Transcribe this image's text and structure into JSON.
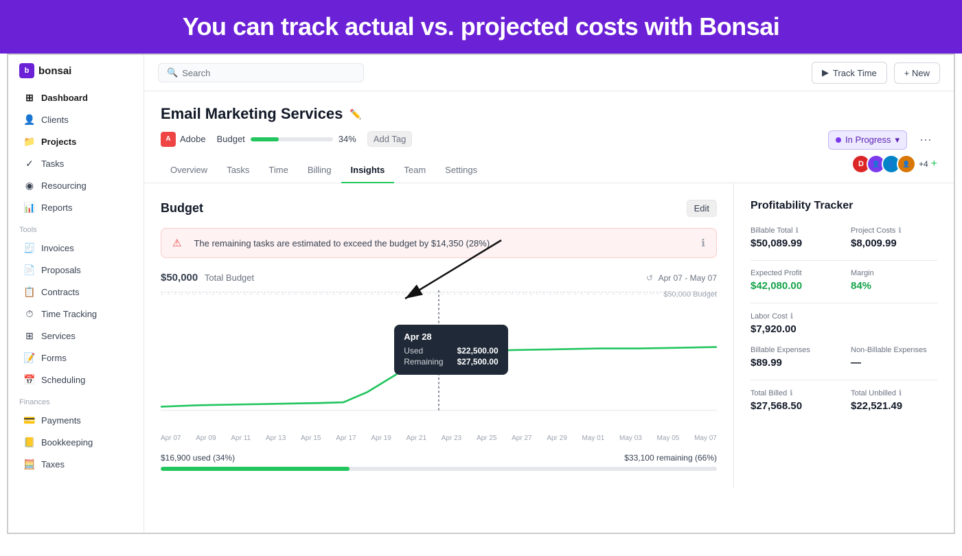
{
  "banner": {
    "text": "You can track actual vs. projected costs with Bonsai"
  },
  "topbar": {
    "search_placeholder": "Search",
    "track_time_label": "Track Time",
    "new_label": "+ New"
  },
  "sidebar": {
    "logo": "bonsai",
    "nav_items": [
      {
        "id": "dashboard",
        "label": "Dashboard",
        "icon": "⊞"
      },
      {
        "id": "clients",
        "label": "Clients",
        "icon": "👤"
      },
      {
        "id": "projects",
        "label": "Projects",
        "icon": "📁",
        "active": true
      },
      {
        "id": "tasks",
        "label": "Tasks",
        "icon": "✓"
      },
      {
        "id": "resourcing",
        "label": "Resourcing",
        "icon": "◉"
      },
      {
        "id": "reports",
        "label": "Reports",
        "icon": "📊"
      }
    ],
    "tools_section": "Tools",
    "tools_items": [
      {
        "id": "invoices",
        "label": "Invoices",
        "icon": "🧾"
      },
      {
        "id": "proposals",
        "label": "Proposals",
        "icon": "📄"
      },
      {
        "id": "contracts",
        "label": "Contracts",
        "icon": "📋"
      },
      {
        "id": "time-tracking",
        "label": "Time Tracking",
        "icon": "⏱"
      },
      {
        "id": "services",
        "label": "Services",
        "icon": "⊞"
      },
      {
        "id": "forms",
        "label": "Forms",
        "icon": "📝"
      },
      {
        "id": "scheduling",
        "label": "Scheduling",
        "icon": "📅"
      }
    ],
    "finances_section": "Finances",
    "finances_items": [
      {
        "id": "payments",
        "label": "Payments",
        "icon": "💳"
      },
      {
        "id": "bookkeeping",
        "label": "Bookkeeping",
        "icon": "📒"
      },
      {
        "id": "taxes",
        "label": "Taxes",
        "icon": "🧮"
      }
    ]
  },
  "project": {
    "title": "Email Marketing Services",
    "client": "Adobe",
    "budget_label": "Budget",
    "budget_percent": "34%",
    "budget_bar_fill": 34,
    "add_tag": "Add Tag",
    "status": "In Progress",
    "avatar_count": "+4"
  },
  "tabs": [
    {
      "id": "overview",
      "label": "Overview",
      "active": false
    },
    {
      "id": "tasks",
      "label": "Tasks",
      "active": false
    },
    {
      "id": "time",
      "label": "Time",
      "active": false
    },
    {
      "id": "billing",
      "label": "Billing",
      "active": false
    },
    {
      "id": "insights",
      "label": "Insights",
      "active": true
    },
    {
      "id": "team",
      "label": "Team",
      "active": false
    },
    {
      "id": "settings",
      "label": "Settings",
      "active": false
    }
  ],
  "budget_section": {
    "title": "Budget",
    "edit_label": "Edit",
    "alert_text": "The remaining tasks are estimated to exceed the budget by $14,350 (28%)",
    "total_budget_label": "Total Budget",
    "total_budget_value": "$50,000",
    "date_range": "Apr 07 - May 07",
    "chart_budget_line": "$50,000 Budget",
    "tooltip": {
      "date": "Apr 28",
      "used_label": "Used",
      "used_value": "$22,500.00",
      "remaining_label": "Remaining",
      "remaining_value": "$27,500.00"
    },
    "x_axis_labels": [
      "Apr 07",
      "Apr 09",
      "Apr 11",
      "Apr 13",
      "Apr 15",
      "Apr 17",
      "Apr 19",
      "Apr 21",
      "Apr 23",
      "Apr 25",
      "Apr 27",
      "Apr 29",
      "May 01",
      "May 03",
      "May 05",
      "May 07"
    ],
    "used_label": "$16,900 used (34%)",
    "remaining_label": "$33,100 remaining (66%)"
  },
  "profitability": {
    "title": "Profitability Tracker",
    "items": [
      {
        "id": "billable-total",
        "label": "Billable Total",
        "value": "$50,089.99",
        "green": false
      },
      {
        "id": "project-costs",
        "label": "Project Costs",
        "value": "$8,009.99",
        "green": false
      },
      {
        "id": "expected-profit",
        "label": "Expected Profit",
        "value": "$42,080.00",
        "green": true
      },
      {
        "id": "margin",
        "label": "Margin",
        "value": "84%",
        "green": true
      },
      {
        "id": "labor-cost",
        "label": "Labor Cost",
        "value": "$7,920.00",
        "green": false
      },
      {
        "id": "billable-expenses-label",
        "label": "Billable Expenses",
        "value": "$89.99",
        "green": false
      },
      {
        "id": "non-billable-expenses-label",
        "label": "Non-Billable Expenses",
        "value": "—",
        "green": false
      },
      {
        "id": "total-billed",
        "label": "Total Billed",
        "value": "$27,568.50",
        "green": false
      },
      {
        "id": "total-unbilled",
        "label": "Total Unbilled",
        "value": "$22,521.49",
        "green": false
      }
    ]
  }
}
